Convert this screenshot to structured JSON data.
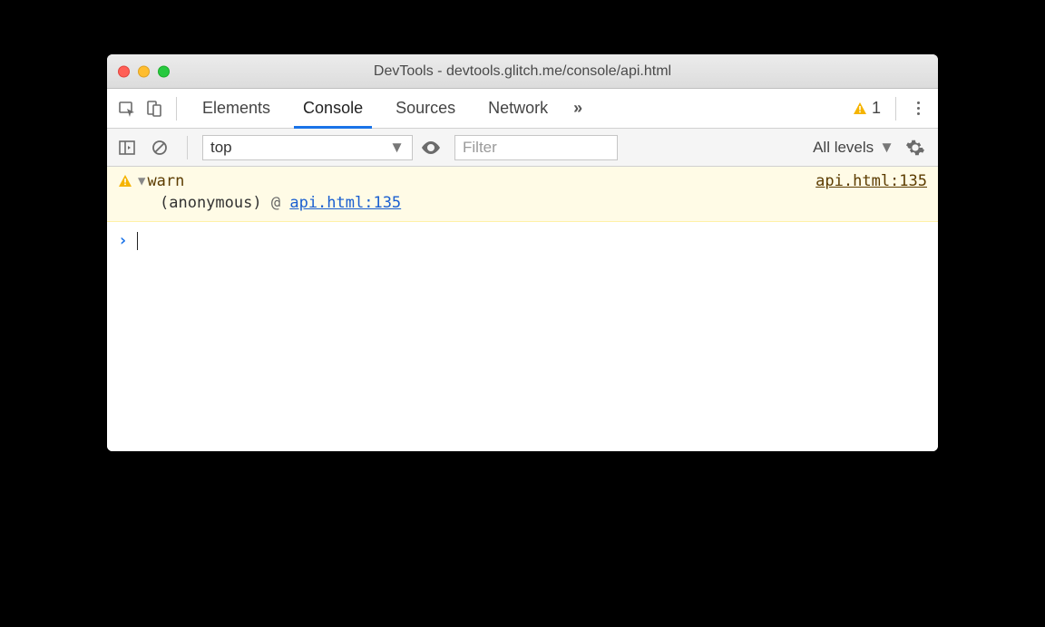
{
  "window": {
    "title": "DevTools - devtools.glitch.me/console/api.html"
  },
  "tabs": {
    "items": [
      "Elements",
      "Console",
      "Sources",
      "Network"
    ],
    "active_index": 1
  },
  "warning_count": "1",
  "toolbar": {
    "context": "top",
    "filter_placeholder": "Filter",
    "levels_label": "All levels"
  },
  "console": {
    "warn": {
      "label": "warn",
      "source_right": "api.html:135",
      "stack_anon": "(anonymous)",
      "stack_at": "@",
      "stack_link": "api.html:135"
    }
  }
}
